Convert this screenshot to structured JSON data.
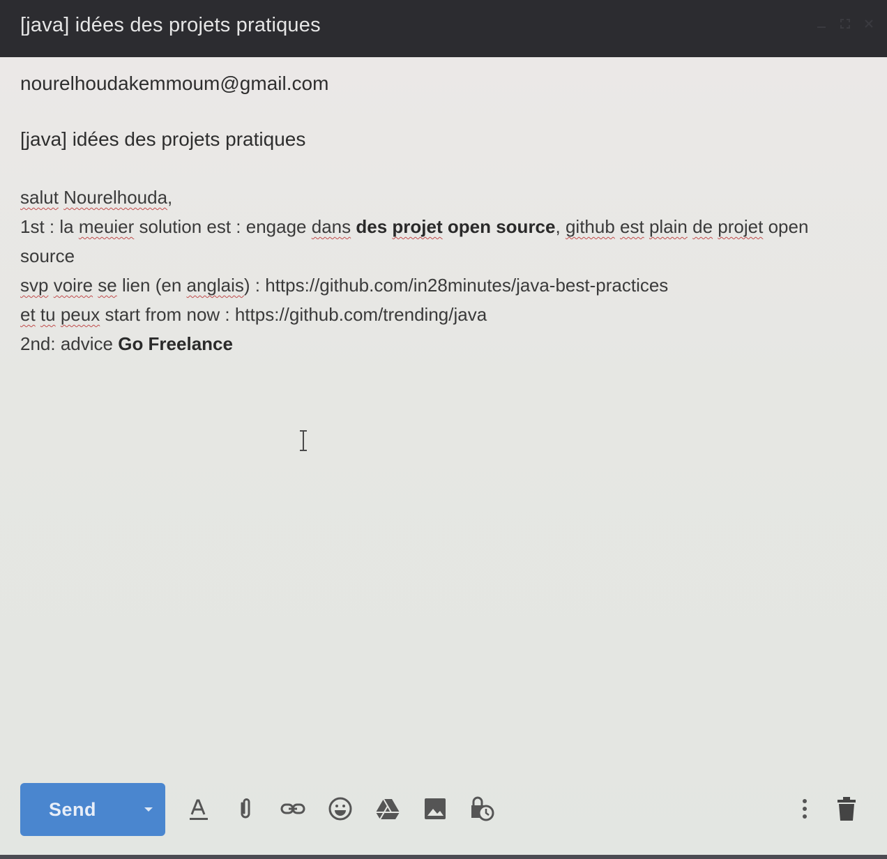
{
  "window": {
    "title": "[java] idées des projets pratiques"
  },
  "compose": {
    "recipient": "nourelhoudakemmoum@gmail.com",
    "subject": "[java] idées des projets pratiques",
    "body": {
      "l1_a": "salut",
      "l1_b": "Nourelhouda",
      "l1_c": ",",
      "l2_a": "1st : la",
      "l2_b": "meuier",
      "l2_c": "solution est : engage",
      "l2_d": "dans",
      "l2_e": "des",
      "l2_f": "projet",
      "l2_g": "open source",
      "l2_h": ",",
      "l2_i": "github",
      "l2_j": "est",
      "l2_k": "plain",
      "l2_l": "de",
      "l2_m": "projet",
      "l2_n": "open",
      "l3": "source",
      "l4_a": "svp",
      "l4_b": "voire",
      "l4_c": "se",
      "l4_d": "lien (en",
      "l4_e": "anglais",
      "l4_f": ") : https://github.com/in28minutes/java-best-practices",
      "l5_a": "et",
      "l5_b": "tu",
      "l5_c": "peux",
      "l5_d": "start from now : https://github.com/trending/java",
      "l6_a": "2nd: advice",
      "l6_b": "Go Freelance"
    }
  },
  "toolbar": {
    "send_label": "Send",
    "icons": [
      "send-options-icon",
      "formatting-icon",
      "attach-icon",
      "link-icon",
      "emoji-icon",
      "drive-icon",
      "photo-icon",
      "confidential-icon",
      "more-options-icon",
      "discard-icon"
    ]
  },
  "colors": {
    "titlebar": "#2c2c30",
    "send_button": "#4a86cf",
    "background": "#e6e7e3",
    "spellcheck": "#c04a4a"
  }
}
